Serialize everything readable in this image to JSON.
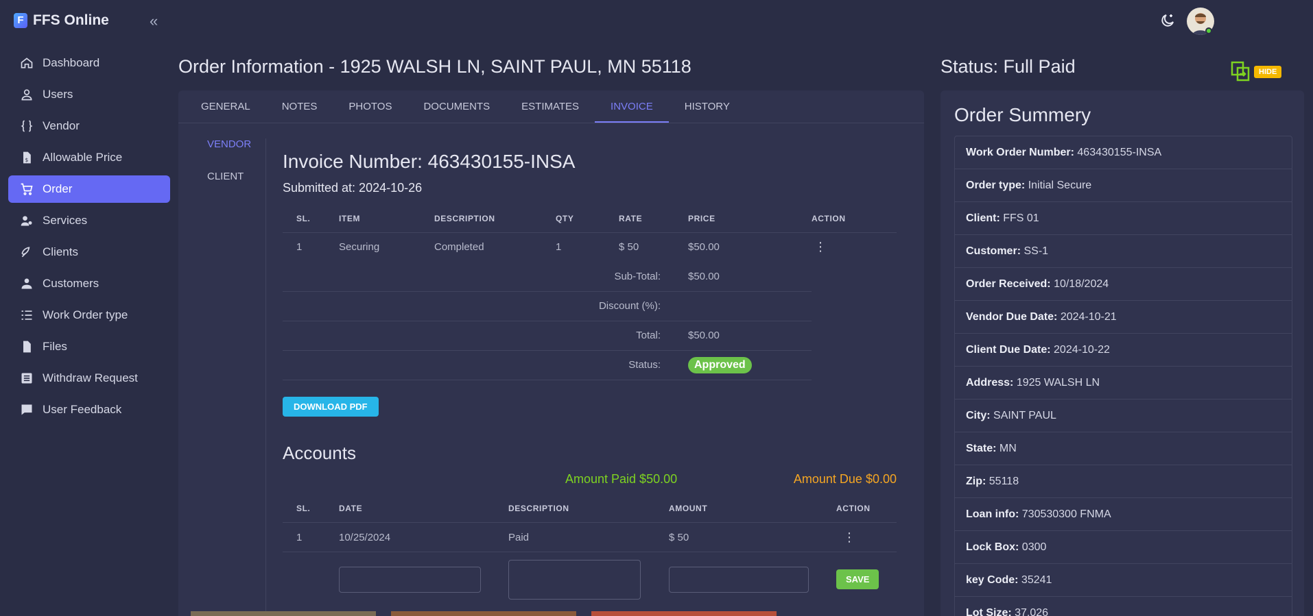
{
  "brand": {
    "name": "FFS Online",
    "logo_letter": "F"
  },
  "sidebar": {
    "items": [
      {
        "label": "Dashboard",
        "icon": "home-icon"
      },
      {
        "label": "Users",
        "icon": "user-icon"
      },
      {
        "label": "Vendor",
        "icon": "braces-icon"
      },
      {
        "label": "Allowable Price",
        "icon": "file-dollar-icon"
      },
      {
        "label": "Order",
        "icon": "cart-icon",
        "active": true
      },
      {
        "label": "Services",
        "icon": "services-icon"
      },
      {
        "label": "Clients",
        "icon": "clients-icon"
      },
      {
        "label": "Customers",
        "icon": "customers-icon"
      },
      {
        "label": "Work Order type",
        "icon": "list-icon"
      },
      {
        "label": "Files",
        "icon": "file-icon"
      },
      {
        "label": "Withdraw Request",
        "icon": "list-box-icon"
      },
      {
        "label": "User Feedback",
        "icon": "chat-icon"
      }
    ]
  },
  "main": {
    "title": "Order Information - 1925 WALSH LN, SAINT PAUL, MN 55118",
    "tabs": [
      "GENERAL",
      "NOTES",
      "PHOTOS",
      "DOCUMENTS",
      "ESTIMATES",
      "INVOICE",
      "HISTORY"
    ],
    "active_tab": "INVOICE",
    "subtabs": [
      "VENDOR",
      "CLIENT"
    ],
    "active_subtab": "VENDOR"
  },
  "invoice": {
    "number": "Invoice Number: 463430155-INSA",
    "submitted": "Submitted at: 2024-10-26",
    "columns": [
      "SL.",
      "ITEM",
      "DESCRIPTION",
      "QTY",
      "RATE",
      "PRICE",
      "ACTION"
    ],
    "rows": [
      {
        "sl": "1",
        "item": "Securing",
        "description": "Completed",
        "qty": "1",
        "rate": "$ 50",
        "price": "$50.00"
      }
    ],
    "subtotal_label": "Sub-Total:",
    "subtotal": "$50.00",
    "discount_label": "Discount (%):",
    "discount": "",
    "total_label": "Total:",
    "total": "$50.00",
    "status_label": "Status:",
    "status": "Approved",
    "download_label": "DOWNLOAD PDF"
  },
  "accounts": {
    "title": "Accounts",
    "amount_paid": "Amount Paid $50.00",
    "amount_due": "Amount Due $0.00",
    "columns": [
      "SL.",
      "DATE",
      "DESCRIPTION",
      "AMOUNT",
      "ACTION"
    ],
    "rows": [
      {
        "sl": "1",
        "date": "10/25/2024",
        "description": "Paid",
        "amount": "$ 50"
      }
    ],
    "save_label": "SAVE"
  },
  "status_panel": {
    "status_title": "Status: Full Paid",
    "hide_label": "HIDE",
    "summary_title": "Order Summery",
    "fields": [
      {
        "label": "Work Order Number",
        "value": "463430155-INSA"
      },
      {
        "label": "Order type",
        "value": "Initial Secure"
      },
      {
        "label": "Client",
        "value": "FFS 01"
      },
      {
        "label": "Customer",
        "value": "SS-1"
      },
      {
        "label": "Order Received",
        "value": "10/18/2024"
      },
      {
        "label": "Vendor Due Date",
        "value": "2024-10-21"
      },
      {
        "label": "Client Due Date",
        "value": "2024-10-22"
      },
      {
        "label": "Address",
        "value": "1925 WALSH LN"
      },
      {
        "label": "City",
        "value": "SAINT PAUL"
      },
      {
        "label": "State",
        "value": "MN"
      },
      {
        "label": "Zip",
        "value": "55118"
      },
      {
        "label": "Loan info",
        "value": "730530300 FNMA"
      },
      {
        "label": "Lock Box",
        "value": "0300"
      },
      {
        "label": "key Code",
        "value": "35241"
      },
      {
        "label": "Lot Size",
        "value": "37,026"
      }
    ]
  },
  "colors": {
    "accent": "#6569f3",
    "approved": "#6cc24a",
    "paid": "#7ed321",
    "due": "#f5a623",
    "hide": "#f5b800",
    "pdf": "#27b5e8"
  }
}
